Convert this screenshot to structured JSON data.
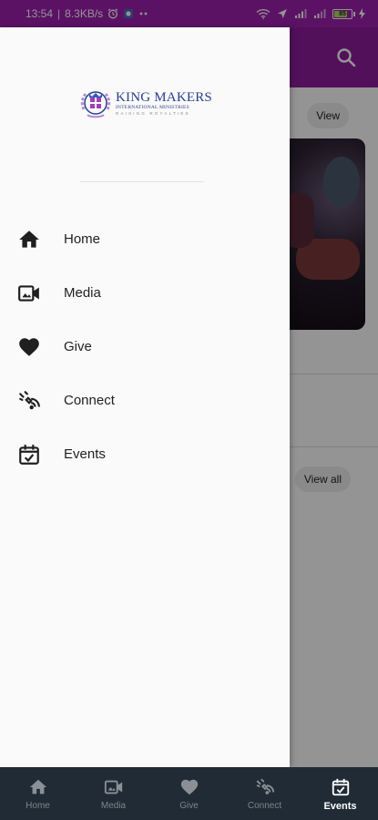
{
  "status_bar": {
    "time": "13:54",
    "network_speed": "8.3KB/s",
    "battery": "85"
  },
  "background": {
    "view_chip": "View",
    "view_all_chip": "View all"
  },
  "drawer": {
    "logo": {
      "title": "KING MAKERS",
      "subtitle": "INTERNATIONAL MINISTRIES",
      "tagline": "RAISING ROYALTIES"
    },
    "items": [
      {
        "label": "Home",
        "icon": "home-icon"
      },
      {
        "label": "Media",
        "icon": "video-camera-icon"
      },
      {
        "label": "Give",
        "icon": "heart-icon"
      },
      {
        "label": "Connect",
        "icon": "connect-icon"
      },
      {
        "label": "Events",
        "icon": "calendar-check-icon"
      }
    ]
  },
  "bottom_nav": {
    "active": "Events",
    "items": [
      {
        "label": "Home",
        "icon": "home-icon"
      },
      {
        "label": "Media",
        "icon": "video-camera-icon"
      },
      {
        "label": "Give",
        "icon": "heart-icon"
      },
      {
        "label": "Connect",
        "icon": "connect-icon"
      },
      {
        "label": "Events",
        "icon": "calendar-check-icon"
      }
    ]
  },
  "colors": {
    "status_bar": "#9d1fae",
    "app_header": "#8e1c9e",
    "bottom_nav": "#202b35",
    "logo_blue": "#2a3f8a"
  }
}
